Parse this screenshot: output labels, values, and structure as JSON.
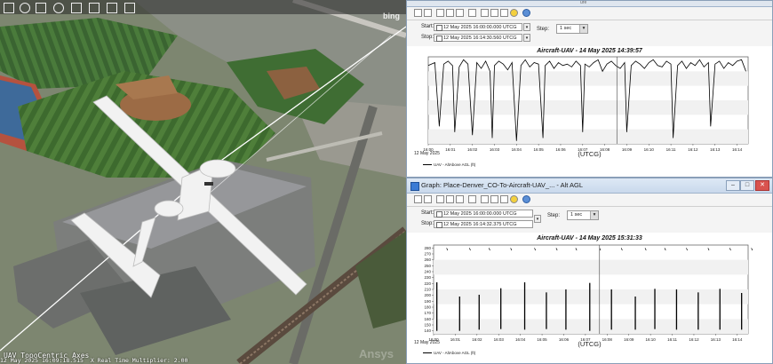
{
  "scene": {
    "bing_label": "bing",
    "axes_label": "UAV TopoCentric Axes",
    "status_text": "12 May 2025 16:09:18.515",
    "multiplier_text": "X Real Time Multiplier: 2.00",
    "watermark": "Ansys",
    "toolbar_icons": [
      "cursor-icon",
      "zoom-icon",
      "pan-icon",
      "globe-icon",
      "ruler-icon",
      "pencil-icon",
      "grid-icon",
      "camera-icon"
    ]
  },
  "graph1": {
    "window_title": "",
    "header_caption": "ure",
    "start_label": "Start:",
    "stop_label": "Stop:",
    "start_value": "12 May 2025 16:00:00.000 UTCG",
    "stop_value": "12 May 2025 16:14:30.560 UTCG",
    "step_label": "Step:",
    "step_value": "1 sec",
    "plot_title": "Aircraft-UAV - 14 May 2025 14:39:57",
    "x_label": "(UTCG)",
    "date_label": "12 May 2025",
    "legend": "UAV - AltAbove AGL (ft)"
  },
  "graph2": {
    "window_title": "Graph: Place-Denver_CO-To-Aircraft-UAV_... - Alt AGL",
    "start_label": "Start:",
    "stop_label": "Stop:",
    "start_value": "12 May 2025 16:00:00.000 UTCG",
    "stop_value": "12 May 2025 16:14:32.375 UTCG",
    "step_label": "Step:",
    "step_value": "1 sec",
    "plot_title": "Aircraft-UAV - 14 May 2025 15:31:33",
    "x_label": "(UTCG)",
    "date_label": "12 May 2025",
    "legend": "UAV - AltAbove AGL (ft)"
  },
  "chart_data": [
    {
      "type": "line",
      "title": "Aircraft-UAV - 14 May 2025 14:39:57",
      "xlabel": "(UTCG)",
      "ylabel": "",
      "categories": [
        "16:00",
        "16:01",
        "16:02",
        "16:03",
        "16:04",
        "16:05",
        "16:06",
        "16:07",
        "16:08",
        "16:09",
        "16:10",
        "16:11",
        "16:12",
        "16:13",
        "16:14"
      ],
      "xlim": [
        0,
        14.5
      ],
      "ylim": [
        0,
        300
      ],
      "yticks_shown": false,
      "grid": true,
      "series": [
        {
          "name": "UAV - AltAbove AGL (ft)",
          "x": [
            0.0,
            0.3,
            0.5,
            0.7,
            0.9,
            1.1,
            1.2,
            1.4,
            1.6,
            1.8,
            2.0,
            2.2,
            2.4,
            2.6,
            2.8,
            2.9,
            3.0,
            3.2,
            3.4,
            3.6,
            3.8,
            4.0,
            4.2,
            4.4,
            4.6,
            4.8,
            5.0,
            5.2,
            5.3,
            5.5,
            5.7,
            5.9,
            6.1,
            6.3,
            6.5,
            6.7,
            6.9,
            7.0,
            7.1,
            7.3,
            7.5,
            7.7,
            7.9,
            8.1,
            8.3,
            8.5,
            8.7,
            8.9,
            9.0,
            9.2,
            9.4,
            9.6,
            9.8,
            10.0,
            10.2,
            10.4,
            10.6,
            10.8,
            11.0,
            11.1,
            11.3,
            11.5,
            11.7,
            11.9,
            12.1,
            12.3,
            12.5,
            12.7,
            12.8,
            13.0,
            13.2,
            13.4,
            13.6,
            13.8,
            14.0,
            14.2,
            14.4
          ],
          "y": [
            270,
            280,
            60,
            275,
            285,
            270,
            40,
            265,
            290,
            275,
            30,
            280,
            260,
            285,
            250,
            20,
            270,
            285,
            275,
            255,
            280,
            10,
            270,
            290,
            265,
            280,
            275,
            20,
            270,
            285,
            260,
            280,
            270,
            275,
            265,
            285,
            270,
            40,
            275,
            265,
            280,
            290,
            250,
            275,
            285,
            270,
            260,
            280,
            40,
            270,
            285,
            275,
            260,
            280,
            290,
            270,
            265,
            285,
            275,
            20,
            270,
            285,
            260,
            280,
            270,
            290,
            265,
            280,
            60,
            275,
            285,
            260,
            280,
            270,
            285,
            290,
            250
          ]
        }
      ]
    },
    {
      "type": "line",
      "title": "Aircraft-UAV - 14 May 2025 15:31:33",
      "xlabel": "(UTCG)",
      "ylabel": "",
      "categories": [
        "16:00",
        "16:01",
        "16:02",
        "16:03",
        "16:04",
        "16:05",
        "16:06",
        "16:07",
        "16:08",
        "16:09",
        "16:10",
        "16:11",
        "16:12",
        "16:13",
        "16:14"
      ],
      "yticks": [
        140,
        150,
        160,
        170,
        180,
        190,
        200,
        210,
        220,
        230,
        240,
        250,
        260,
        270,
        280
      ],
      "xlim": [
        0,
        14.5
      ],
      "ylim": [
        135,
        285
      ],
      "grid": true,
      "series": [
        {
          "name": "UAV - AltAbove AGL (ft)",
          "spikes": [
            {
              "x": 0.15,
              "top": 222,
              "bottom": 140
            },
            {
              "x": 1.2,
              "top": 198,
              "bottom": 140
            },
            {
              "x": 2.1,
              "top": 201,
              "bottom": 142
            },
            {
              "x": 3.1,
              "top": 212,
              "bottom": 143
            },
            {
              "x": 4.2,
              "top": 222,
              "bottom": 142
            },
            {
              "x": 5.2,
              "top": 205,
              "bottom": 143
            },
            {
              "x": 6.1,
              "top": 210,
              "bottom": 142
            },
            {
              "x": 7.2,
              "top": 221,
              "bottom": 140
            },
            {
              "x": 8.2,
              "top": 210,
              "bottom": 142
            },
            {
              "x": 9.3,
              "top": 198,
              "bottom": 142
            },
            {
              "x": 10.2,
              "top": 211,
              "bottom": 143
            },
            {
              "x": 11.2,
              "top": 210,
              "bottom": 142
            },
            {
              "x": 12.2,
              "top": 205,
              "bottom": 142
            },
            {
              "x": 13.2,
              "top": 211,
              "bottom": 142
            },
            {
              "x": 14.2,
              "top": 204,
              "bottom": 142
            }
          ],
          "top_marks_y": 280
        }
      ]
    }
  ],
  "colors": {
    "series": "#000000",
    "window_border": "#8a9fb8",
    "title_bar": "#c9d9ec"
  }
}
